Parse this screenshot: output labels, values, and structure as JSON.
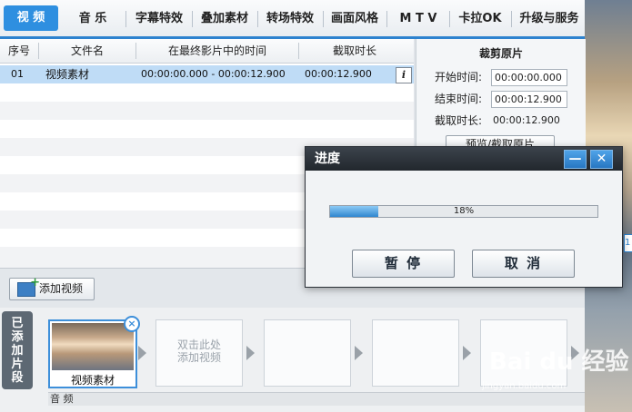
{
  "tabs": [
    {
      "label": "视 频",
      "active": true
    },
    {
      "label": "音 乐"
    },
    {
      "label": "字幕特效"
    },
    {
      "label": "叠加素材"
    },
    {
      "label": "转场特效"
    },
    {
      "label": "画面风格"
    },
    {
      "label": "M T V"
    },
    {
      "label": "卡拉OK"
    },
    {
      "label": "升级与服务"
    }
  ],
  "table": {
    "headers": [
      "序号",
      "文件名",
      "在最终影片中的时间",
      "截取时长"
    ],
    "rows": [
      {
        "index": "01",
        "filename": "视频素材",
        "time_range": "00:00:00.000 - 00:00:12.900",
        "duration": "00:00:12.900",
        "info": "i"
      }
    ]
  },
  "crop_panel": {
    "title": "裁剪原片",
    "start_label": "开始时间:",
    "start_value": "00:00:00.000",
    "end_label": "结束时间:",
    "end_value": "00:00:12.900",
    "duration_label": "截取时长:",
    "duration_value": "00:00:12.900",
    "preview_button": "预览/截取原片"
  },
  "add_video": {
    "label": "添加视频"
  },
  "clip_strip": {
    "side_label": "已添加片段",
    "clips": [
      {
        "label": "视频素材"
      }
    ],
    "empty_hint": "双击此处\n添加视频",
    "audio_label": "音 频"
  },
  "dialog": {
    "title": "进度",
    "progress_percent": 18,
    "progress_text": "18%",
    "pause_label": "暂 停",
    "cancel_label": "取 消",
    "minimize_glyph": "—",
    "close_glyph": "✕"
  },
  "watermark": {
    "brand": "Bai du 经验",
    "url": "jingyan.baidu.com"
  },
  "side_sliver": {
    "text": "1"
  },
  "colors": {
    "accent": "#2e8fe0",
    "selected_row": "#bfdcf6",
    "dialog_titlebar": "#2b3138"
  }
}
